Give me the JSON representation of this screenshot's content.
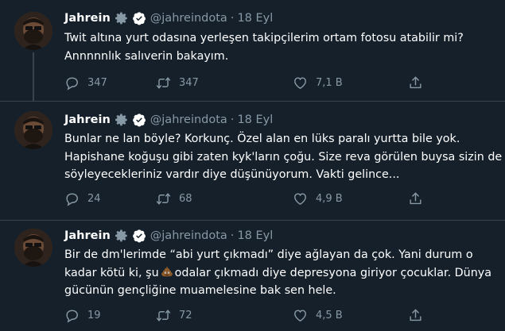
{
  "tweets": [
    {
      "name": "Jahrein",
      "handle": "@jahreindota",
      "separator": "·",
      "date": "18 Eyl",
      "lines": [
        "Twit altına yurt odasına yerleşen takipçilerim ortam fotosu atabilir mi?",
        "Annnnnlık salıverin bakayım."
      ],
      "replies": "347",
      "retweets": "347",
      "likes": "7,1 B"
    },
    {
      "name": "Jahrein",
      "handle": "@jahreindota",
      "separator": "·",
      "date": "18 Eyl",
      "lines": [
        "Bunlar ne lan böyle? Korkunç. Özel alan en lüks paralı yurtta bile yok.",
        "Hapishane koğuşu gibi zaten kyk'ların çoğu. Size reva görülen buysa sizin de",
        "söyleyecekleriniz vardır diye düşünüyorum. Vakti gelince..."
      ],
      "replies": "24",
      "retweets": "68",
      "likes": "4,9 B"
    },
    {
      "name": "Jahrein",
      "handle": "@jahreindota",
      "separator": "·",
      "date": "18 Eyl",
      "line1": "Bir de dm'lerimde “abi yurt çıkmadı” diye ağlayan da çok. Yani durum o",
      "line2_before": "kadar kötü ki, şu",
      "line2_after": "odalar çıkmadı diye depresyona giriyor çocuklar. Dünya",
      "line3": "gücünün gençliğine muamelesine bak sen hele.",
      "replies": "19",
      "retweets": "72",
      "likes": "4,5 B"
    }
  ],
  "icons": {
    "badge": "gear-badge-icon",
    "verified": "verified-icon",
    "reply": "reply-icon",
    "retweet": "retweet-icon",
    "like": "heart-icon",
    "share": "share-icon",
    "emoji": "poop-emoji-icon"
  },
  "colors": {
    "background": "#15202b",
    "text": "#ffffff",
    "muted": "#8899a6",
    "divider": "#38444d"
  }
}
